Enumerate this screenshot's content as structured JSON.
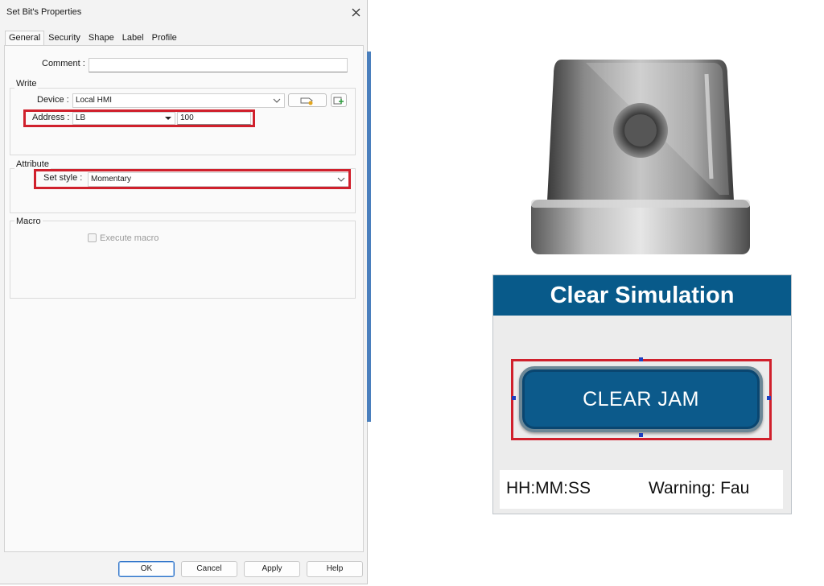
{
  "dialog": {
    "title": "Set Bit's Properties",
    "tabs": [
      "General",
      "Security",
      "Shape",
      "Label",
      "Profile"
    ],
    "active_tab": "General",
    "comment": {
      "label": "Comment :",
      "value": ""
    },
    "write": {
      "title": "Write",
      "device": {
        "label": "Device :",
        "value": "Local HMI"
      },
      "address": {
        "label": "Address :",
        "type": "LB",
        "value": "100"
      }
    },
    "attribute": {
      "title": "Attribute",
      "set_style": {
        "label": "Set style :",
        "value": "Momentary"
      }
    },
    "macro": {
      "title": "Macro",
      "execute_label": "Execute macro",
      "execute_checked": false
    },
    "buttons": {
      "ok": "OK",
      "cancel": "Cancel",
      "apply": "Apply",
      "help": "Help"
    },
    "highlight_color": "#d0202c"
  },
  "hmi": {
    "header_title": "Clear Simulation",
    "button_label": "CLEAR JAM",
    "status_time": "HH:MM:SS",
    "status_warning": "Warning: Fau",
    "header_color": "#085a8a",
    "button_color": "#0c5a8b"
  }
}
